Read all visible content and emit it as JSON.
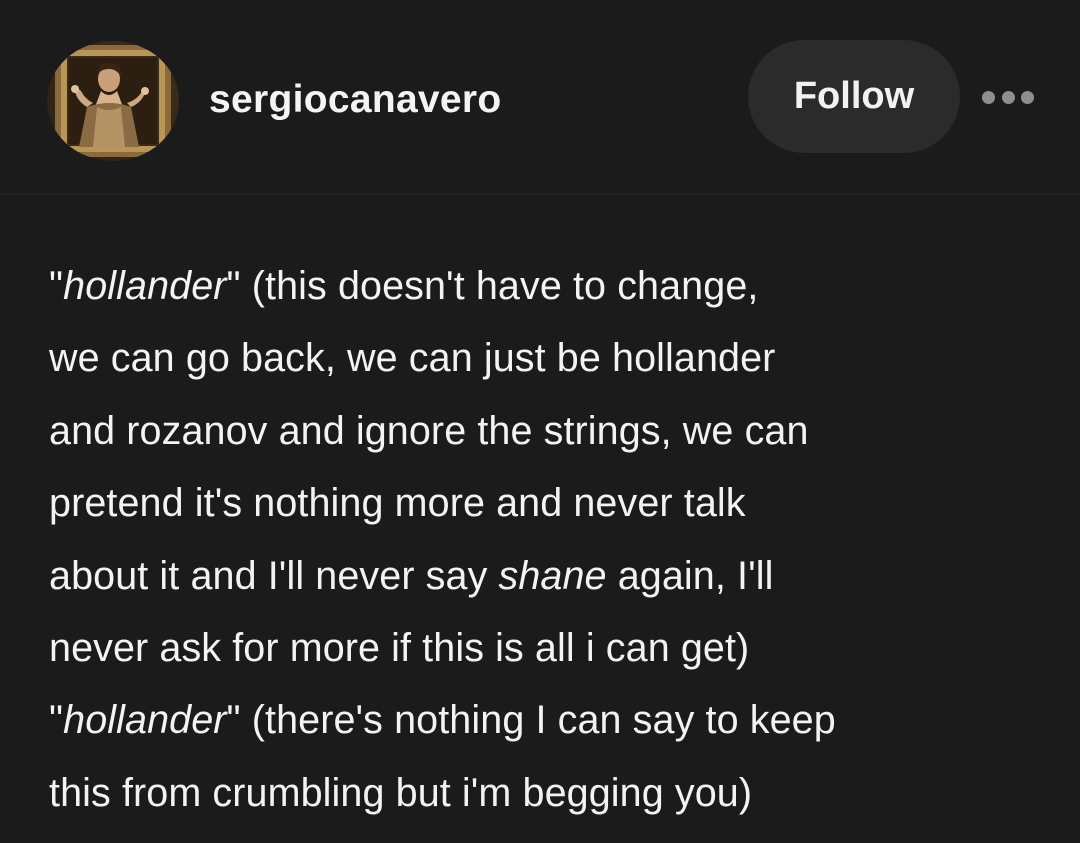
{
  "author": {
    "username": "sergiocanavero",
    "avatar_icon": "painting-avatar-icon"
  },
  "actions": {
    "follow_label": "Follow",
    "more_icon": "more-dots-icon"
  },
  "post": {
    "lines": [
      {
        "pre": "\"",
        "em": "hollander",
        "post": "\" (this doesn't have to change,"
      },
      {
        "text": "we can go back, we can just be hollander"
      },
      {
        "text": "and rozanov and ignore the strings, we can"
      },
      {
        "text": "pretend it's nothing more and never talk"
      },
      {
        "pre": "about it and I'll never say ",
        "em": "shane",
        "post": " again, I'll"
      },
      {
        "text": "never ask for more if this is all i can get)"
      },
      {
        "pre": "\"",
        "em": "hollander",
        "post": "\" (there's nothing I can say to keep"
      },
      {
        "text": "this from crumbling but i'm begging you)"
      }
    ]
  },
  "colors": {
    "background": "#1b1b1b",
    "button_bg": "#2b2b2b",
    "text": "#f3f3f3",
    "dots": "#8f8f8f"
  }
}
